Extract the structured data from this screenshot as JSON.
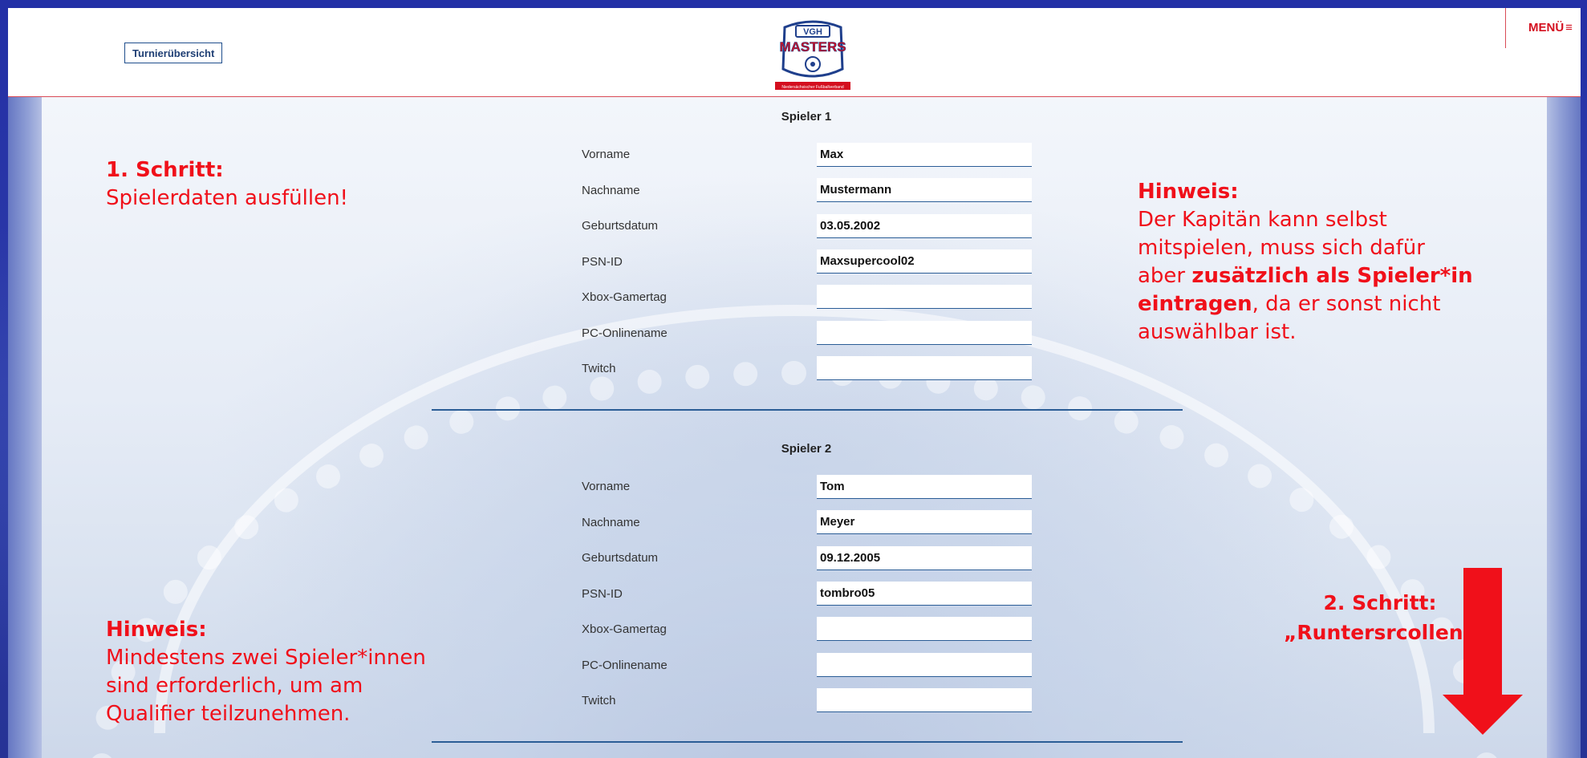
{
  "header": {
    "overview_button": "Turnierübersicht",
    "logo_top": "VGH",
    "logo_main": "MASTERS",
    "logo_sub": "Niedersächsischer Fußballverband",
    "menu_label": "MENÜ",
    "menu_icon": "hamburger-icon"
  },
  "labels": {
    "first_name": "Vorname",
    "last_name": "Nachname",
    "birthdate": "Geburtsdatum",
    "psn": "PSN-ID",
    "xbox": "Xbox-Gamertag",
    "pc": "PC-Onlinename",
    "twitch": "Twitch"
  },
  "players": [
    {
      "title": "Spieler 1",
      "first_name": "Max",
      "last_name": "Mustermann",
      "birthdate": "03.05.2002",
      "psn": "Maxsupercool02",
      "xbox": "",
      "pc": "",
      "twitch": ""
    },
    {
      "title": "Spieler 2",
      "first_name": "Tom",
      "last_name": "Meyer",
      "birthdate": "09.12.2005",
      "psn": "tombro05",
      "xbox": "",
      "pc": "",
      "twitch": ""
    }
  ],
  "annotations": {
    "step1_title": "1. Schritt:",
    "step1_text": "Spielerdaten ausfüllen!",
    "hint1_title": "Hinweis:",
    "hint1_line1": "Der Kapitän kann selbst",
    "hint1_line2": "mitspielen, muss sich dafür",
    "hint1_line3_pre": "aber ",
    "hint1_line3_bold": "zusätzlich als Spieler*in",
    "hint1_line4_bold": "eintragen",
    "hint1_line4_post": ", da er sonst nicht",
    "hint1_line5": "auswählbar ist.",
    "hint2_title": "Hinweis:",
    "hint2_line1": "Mindestens zwei Spieler*innen",
    "hint2_line2": "sind erforderlich, um am",
    "hint2_line3": "Qualifier teilzunehmen.",
    "step2_title": "2. Schritt:",
    "step2_text": "„Runtersrcollen“"
  },
  "colors": {
    "accent_red": "#f0101a",
    "brand_blue": "#2b5d96",
    "frame_blue": "#2a2f9e"
  }
}
